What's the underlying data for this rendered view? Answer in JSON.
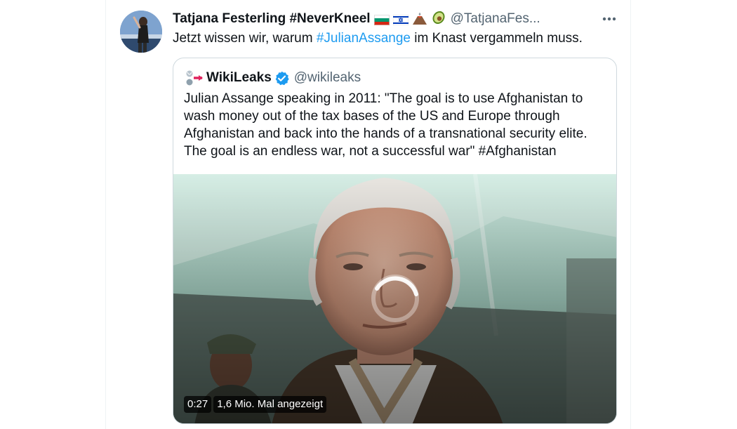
{
  "tweet": {
    "display_name": "Tatjana Festerling #NeverKneel",
    "handle": "@TatjanaFes...",
    "text_before": "Jetzt wissen wir, warum ",
    "hashtag": "#JulianAssange",
    "text_after": " im Knast vergammeln muss.",
    "more_icon": "more-horizontal-icon",
    "emojis": [
      "bulgaria-flag",
      "israel-flag",
      "volcano",
      "avocado"
    ]
  },
  "quoted_tweet": {
    "display_name": "WikiLeaks",
    "handle": "@wikileaks",
    "verified_icon": "verified-badge-icon",
    "text_lines": [
      "Julian Assange speaking in 2011: \"The goal is to use Afghanistan to",
      "wash money out of the tax bases of the US and Europe through",
      "Afghanistan and back into the hands of a transnational security elite.",
      "The goal is an endless war, not a successful war\" #Afghanistan"
    ]
  },
  "video": {
    "duration": "0:27",
    "views": "1,6 Mio. Mal angezeigt",
    "loading_icon": "loading-spinner-icon"
  },
  "colors": {
    "link": "#1d9bf0",
    "text": "#0f1419",
    "secondary": "#536471",
    "verified": "#1d9bf0",
    "border": "#cfd9de"
  }
}
